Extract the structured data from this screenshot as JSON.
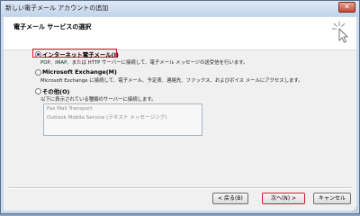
{
  "window": {
    "title": "新しい電子メール アカウントの追加",
    "close_glyph": "✕"
  },
  "header": {
    "title": "電子メール サービスの選択",
    "icon": "cursor-click-icon"
  },
  "options": [
    {
      "label": "インターネット電子メール(I)",
      "description": "POP、IMAP、または HTTP サーバーに接続して、電子メール メッセージの送受信を行います。",
      "selected": true
    },
    {
      "label": "Microsoft Exchange(M)",
      "description": "Microsoft Exchange に接続して、電子メール、予定表、連絡先、ファックス、およびボイス メールにアクセスします。",
      "selected": false
    },
    {
      "label": "その他(O)",
      "description": "以下に表示されている種類のサーバーに接続します。",
      "selected": false
    }
  ],
  "other_servers": [
    "Fax Mail Transport",
    "Outlook Mobile Service (テキスト メッセージング)"
  ],
  "buttons": {
    "back": "< 戻る(B)",
    "next": "次へ(N) >",
    "cancel": "キャンセル"
  },
  "colors": {
    "highlight": "#e3162b",
    "window_frame": "#c9d9ee"
  }
}
